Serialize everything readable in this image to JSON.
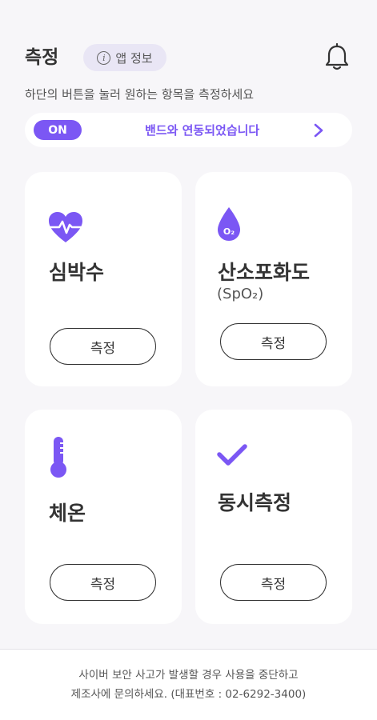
{
  "header": {
    "title": "측정",
    "app_info_label": "앱 정보",
    "info_glyph": "i",
    "subtitle": "하단의 버튼을 눌러 원하는 항목을 측정하세요"
  },
  "band": {
    "status": "ON",
    "message": "밴드와 연동되었습니다"
  },
  "cards": [
    {
      "title": "심박수",
      "button": "측정",
      "icon": "heart-rate-icon"
    },
    {
      "title": "산소포화도",
      "subtitle": "(SpO₂)",
      "button": "측정",
      "icon": "oxygen-drop-icon",
      "icon_text": "O₂"
    },
    {
      "title": "체온",
      "button": "측정",
      "icon": "thermometer-icon"
    },
    {
      "title": "동시측정",
      "button": "측정",
      "icon": "checkmark-icon"
    }
  ],
  "footer": {
    "line1": "사이버 보안 사고가 발생할 경우 사용을 중단하고",
    "line2": "제조사에 문의하세요. (대표번호 : 02-6292-3400)"
  },
  "colors": {
    "accent": "#7b57f4",
    "chip_bg": "#e9e6f5",
    "background": "#f7f6f9"
  }
}
